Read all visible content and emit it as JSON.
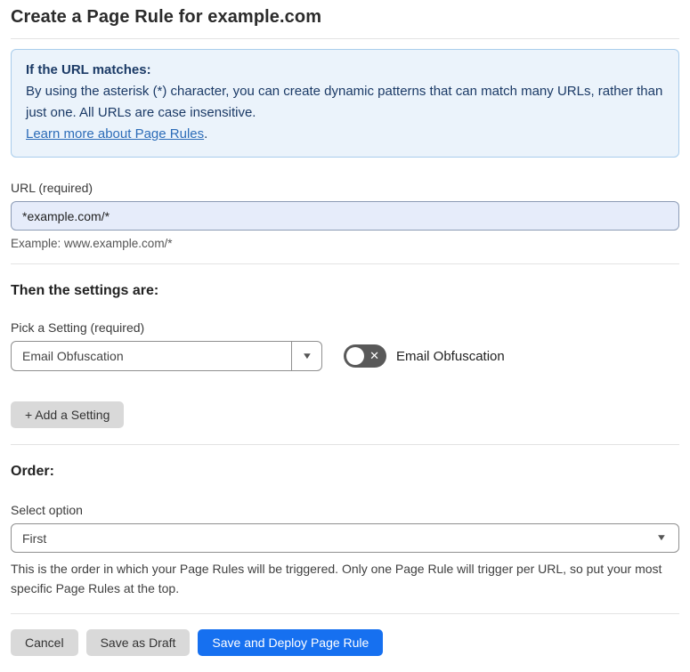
{
  "page": {
    "title": "Create a Page Rule for example.com"
  },
  "info_box": {
    "heading": "If the URL matches:",
    "body": "By using the asterisk (*) character, you can create dynamic patterns that can match many URLs, rather than just one. All URLs are case insensitive.",
    "link_label": "Learn more about Page Rules",
    "link_suffix": "."
  },
  "url_section": {
    "label": "URL (required)",
    "value": "*example.com/*",
    "hint": "Example: www.example.com/*"
  },
  "settings_section": {
    "heading": "Then the settings are:",
    "picker_label": "Pick a Setting (required)",
    "picker_value": "Email Obfuscation",
    "toggle_state": "off",
    "toggle_label": "Email Obfuscation",
    "add_button_label": "+ Add a Setting"
  },
  "order_section": {
    "heading": "Order:",
    "label": "Select option",
    "value": "First",
    "help": "This is the order in which your Page Rules will be triggered. Only one Page Rule will trigger per URL, so put your most specific Page Rules at the top."
  },
  "footer": {
    "cancel_label": "Cancel",
    "save_draft_label": "Save as Draft",
    "save_deploy_label": "Save and Deploy Page Rule"
  },
  "icons": {
    "dropdown_arrow": "▼",
    "toggle_off_x": "✕"
  },
  "colors": {
    "primary_button_blue": "#1670f0",
    "info_box_background": "#ebf3fb",
    "info_box_border": "#a9cdec",
    "info_text_navy": "#1b3a66",
    "link_blue": "#2c6cb8",
    "url_input_background": "#e6ecfa",
    "toggle_off_gray": "#595959",
    "secondary_button_gray": "#d9d9d9"
  }
}
